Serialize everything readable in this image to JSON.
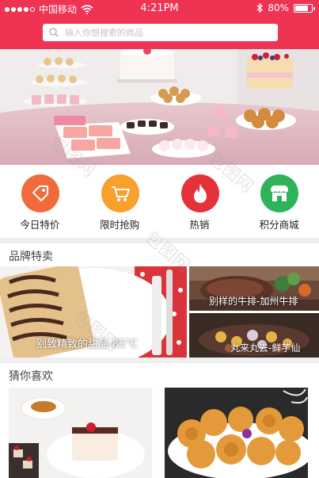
{
  "status_bar": {
    "carrier": "中国移动",
    "time": "4:21PM",
    "battery_text": "80%",
    "battery_level": 0.8,
    "icons": [
      "signal-dots-icon",
      "wifi-icon",
      "bluetooth-icon",
      "battery-icon"
    ]
  },
  "search": {
    "placeholder": "输入你想搜索的商品",
    "icon": "search-icon"
  },
  "categories": [
    {
      "label": "今日特价",
      "icon": "price-tag-icon",
      "color": "#f06a3c"
    },
    {
      "label": "限时抢购",
      "icon": "shopping-cart-icon",
      "color": "#f7a02c"
    },
    {
      "label": "热销",
      "icon": "flame-icon",
      "color": "#e5313a"
    },
    {
      "label": "积分商城",
      "icon": "store-icon",
      "color": "#2fb35a"
    }
  ],
  "brand_sale": {
    "title": "品牌特卖",
    "items": [
      {
        "caption": "别致精致的甜品-85°C"
      },
      {
        "caption": "别样的牛排-加州牛排"
      },
      {
        "caption": "丸来丸去-鲜芋仙"
      }
    ]
  },
  "guess": {
    "title": "猜你喜欢"
  },
  "colors": {
    "brand": "#ef3353",
    "divider": "#efefef"
  }
}
